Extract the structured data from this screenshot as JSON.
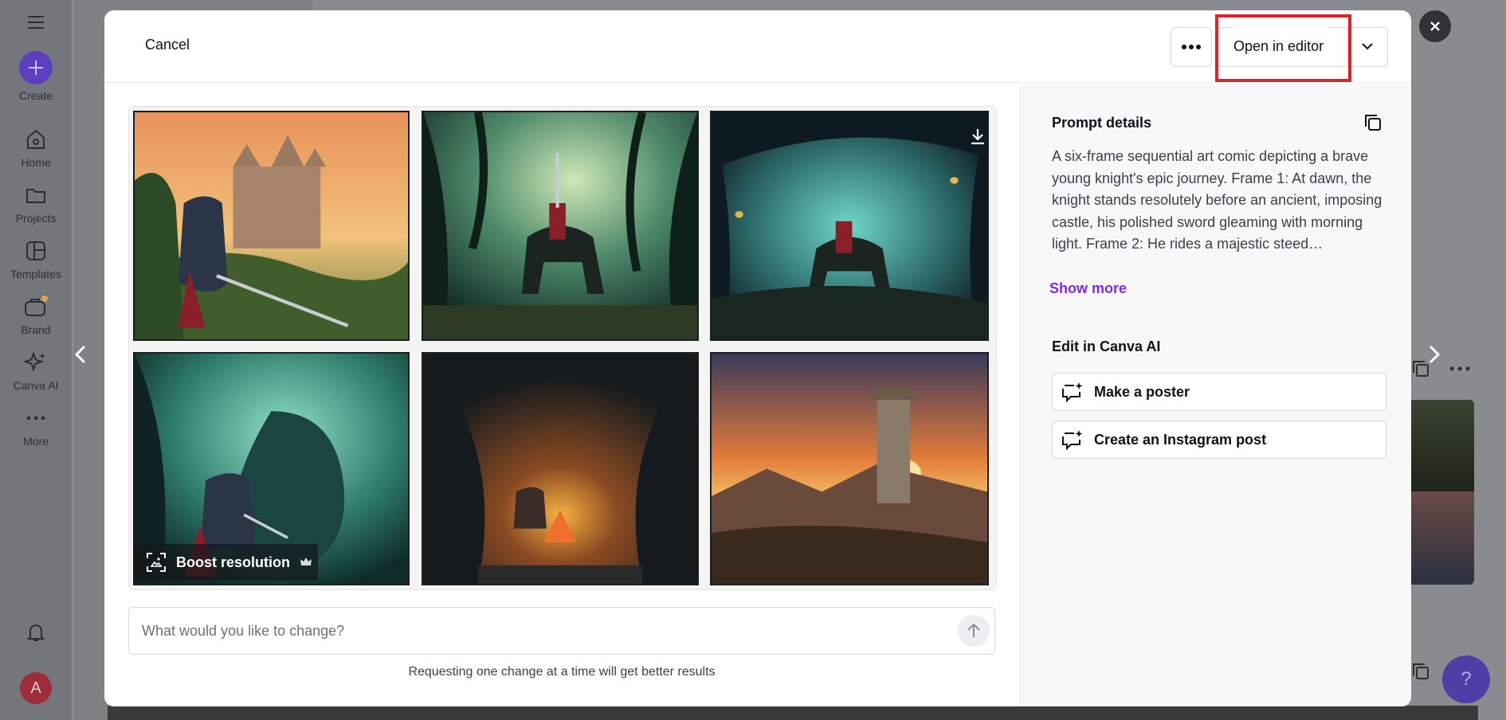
{
  "sidebar": {
    "create_label": "Create",
    "items": [
      {
        "label": "Home",
        "icon": "home-icon"
      },
      {
        "label": "Projects",
        "icon": "folder-icon"
      },
      {
        "label": "Templates",
        "icon": "templates-icon"
      },
      {
        "label": "Brand",
        "icon": "brand-icon"
      },
      {
        "label": "Canva AI",
        "icon": "sparkle-icon"
      },
      {
        "label": "More",
        "icon": "more-icon"
      }
    ],
    "avatar_initial": "A"
  },
  "modal": {
    "cancel_label": "Cancel",
    "open_in_editor_label": "Open in editor",
    "boost_label": "Boost resolution",
    "prompt_placeholder": "What would you like to change?",
    "hint": "Requesting one change at a time will get better results"
  },
  "details": {
    "title": "Prompt details",
    "text": "A six-frame sequential art comic depicting a brave young knight's epic journey. Frame 1: At dawn, the knight stands resolutely before an ancient, imposing castle, his polished sword gleaming with morning light. Frame 2: He rides a majestic steed…",
    "show_more": "Show more",
    "edit_title": "Edit in Canva AI",
    "actions": [
      {
        "label": "Make a poster"
      },
      {
        "label": "Create an Instagram post"
      }
    ]
  },
  "help_label": "?"
}
